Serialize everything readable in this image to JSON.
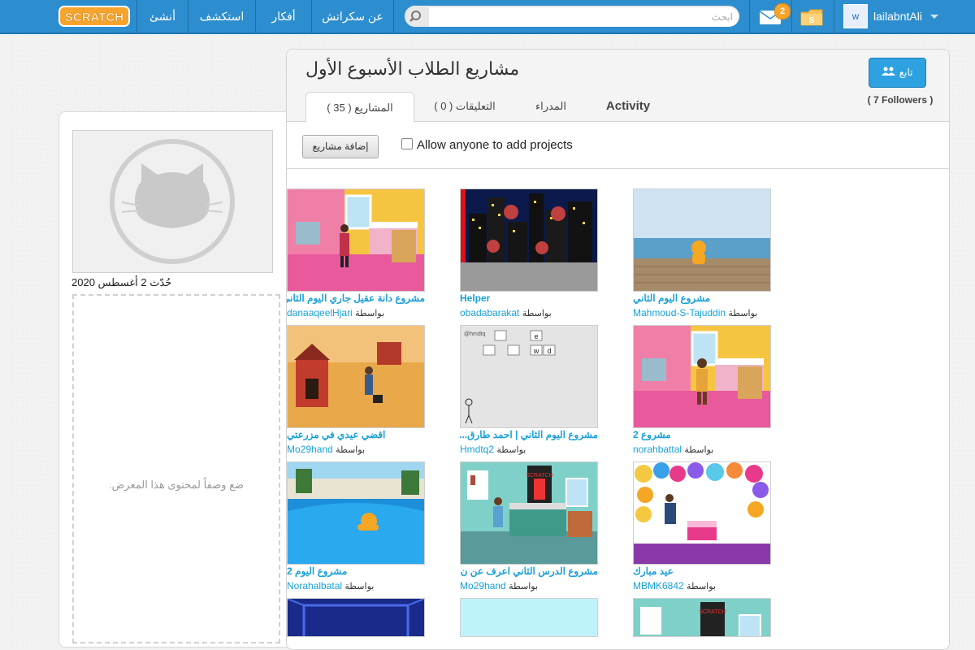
{
  "nav": {
    "about": "عن سكراتش",
    "ideas": "أفكار",
    "explore": "استكشف",
    "create": "أنشئ",
    "search_placeholder": "ابحث",
    "messages_count": "2",
    "username": "lailabntAli"
  },
  "studio": {
    "title": "مشاريع الطلاب الأسبوع الأول",
    "follow_label": "تابع",
    "followers": "( 7 Followers )",
    "created": "حُدّث 2 أغسطس 2020",
    "description_placeholder": "ضع وصفاً لمحتوى هذا المعرض.",
    "add_projects_button": "إضافة مشاريع",
    "allow_anyone_label": "Allow anyone to add projects",
    "allow_anyone_checked": false
  },
  "tabs": [
    {
      "label": "( المشاريع ( 35",
      "active": true
    },
    {
      "label": "( التعليقات ( 0",
      "active": false
    },
    {
      "label": "المدراء",
      "active": false
    },
    {
      "label": "Activity",
      "active": false
    }
  ],
  "projects": [
    {
      "title": "مشروع دانة عقيل جاري اليوم الثاني",
      "by": "بواسطة",
      "user": "danaaqeelHjari"
    },
    {
      "title": "Helper",
      "by": "بواسطة",
      "user": "obadabarakat"
    },
    {
      "title": "مشروع اليوم الثاني",
      "by": "بواسطة",
      "user": "Mahmoud-S-Tajuddin"
    },
    {
      "title": "اقضي عيدي في مزرعتي",
      "by": "بواسطة",
      "user": "Mo29hand"
    },
    {
      "title": "مشروع اليوم الثاني | احمد طارق...",
      "by": "بواسطة",
      "user": "Hmdtq2"
    },
    {
      "title": "مشروع 2",
      "by": "بواسطة",
      "user": "norahbattal"
    },
    {
      "title": "مشروع اليوم 2",
      "by": "بواسطة",
      "user": "Norahalbatal"
    },
    {
      "title": "مشروع الدرس الثاني اعرف عن ن...",
      "by": "بواسطة",
      "user": "Mo29hand"
    },
    {
      "title": "عيد مبارك",
      "by": "بواسطة",
      "user": "MBMK6842"
    }
  ],
  "icons": {
    "logo": "scratch-logo",
    "search": "search-icon",
    "messages": "envelope-icon",
    "mystuff": "folder-icon",
    "user": "avatar",
    "follow": "users-icon",
    "placeholder": "cat-icon"
  },
  "colors": {
    "nav_bg": "#2d8ecf",
    "link": "#1aa0d8",
    "follow_button": "#2ea2e0",
    "badge": "#f7a42c"
  }
}
